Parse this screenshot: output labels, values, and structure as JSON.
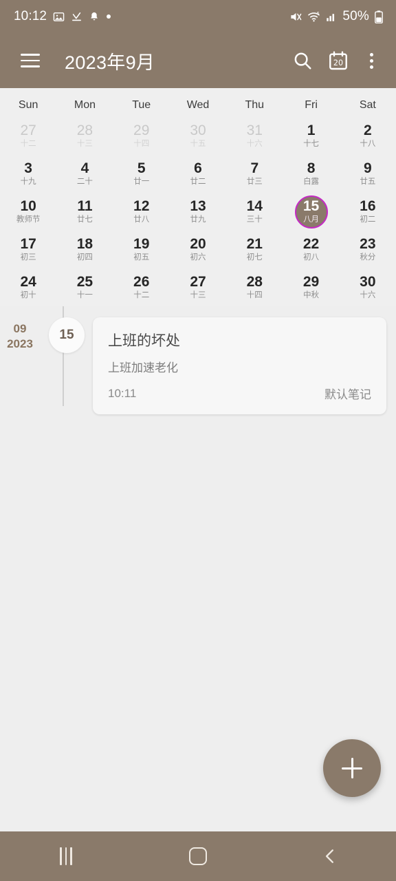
{
  "status_bar": {
    "clock": "10:12",
    "battery_percent": "50%",
    "left_icons": [
      "image-icon",
      "download-complete-icon",
      "bell-icon",
      "dot-indicator-icon"
    ],
    "right_icons": [
      "mute-icon",
      "wifi-6-icon",
      "signal-bars-icon",
      "battery-icon"
    ]
  },
  "app_bar": {
    "menu_icon": "hamburger-icon",
    "title": "2023年9月",
    "actions": [
      {
        "icon": "search-icon",
        "label": "Search"
      },
      {
        "icon": "calendar-today-icon",
        "label": "20"
      },
      {
        "icon": "overflow-menu-icon",
        "label": "More options"
      }
    ]
  },
  "calendar": {
    "weekdays": [
      "Sun",
      "Mon",
      "Tue",
      "Wed",
      "Thu",
      "Fri",
      "Sat"
    ],
    "weeks": [
      [
        {
          "num": "27",
          "lunar": "十二",
          "outside": true
        },
        {
          "num": "28",
          "lunar": "十三",
          "outside": true
        },
        {
          "num": "29",
          "lunar": "十四",
          "outside": true
        },
        {
          "num": "30",
          "lunar": "十五",
          "outside": true
        },
        {
          "num": "31",
          "lunar": "十六",
          "outside": true
        },
        {
          "num": "1",
          "lunar": "十七",
          "outside": false
        },
        {
          "num": "2",
          "lunar": "十八",
          "outside": false
        }
      ],
      [
        {
          "num": "3",
          "lunar": "十九",
          "outside": false
        },
        {
          "num": "4",
          "lunar": "二十",
          "outside": false
        },
        {
          "num": "5",
          "lunar": "廿一",
          "outside": false
        },
        {
          "num": "6",
          "lunar": "廿二",
          "outside": false
        },
        {
          "num": "7",
          "lunar": "廿三",
          "outside": false
        },
        {
          "num": "8",
          "lunar": "白露",
          "outside": false
        },
        {
          "num": "9",
          "lunar": "廿五",
          "outside": false
        }
      ],
      [
        {
          "num": "10",
          "lunar": "教师节",
          "outside": false
        },
        {
          "num": "11",
          "lunar": "廿七",
          "outside": false
        },
        {
          "num": "12",
          "lunar": "廿八",
          "outside": false
        },
        {
          "num": "13",
          "lunar": "廿九",
          "outside": false
        },
        {
          "num": "14",
          "lunar": "三十",
          "outside": false
        },
        {
          "num": "15",
          "lunar": "八月",
          "outside": false,
          "selected": true
        },
        {
          "num": "16",
          "lunar": "初二",
          "outside": false
        }
      ],
      [
        {
          "num": "17",
          "lunar": "初三",
          "outside": false
        },
        {
          "num": "18",
          "lunar": "初四",
          "outside": false
        },
        {
          "num": "19",
          "lunar": "初五",
          "outside": false
        },
        {
          "num": "20",
          "lunar": "初六",
          "outside": false
        },
        {
          "num": "21",
          "lunar": "初七",
          "outside": false
        },
        {
          "num": "22",
          "lunar": "初八",
          "outside": false
        },
        {
          "num": "23",
          "lunar": "秋分",
          "outside": false
        }
      ],
      [
        {
          "num": "24",
          "lunar": "初十",
          "outside": false
        },
        {
          "num": "25",
          "lunar": "十一",
          "outside": false
        },
        {
          "num": "26",
          "lunar": "十二",
          "outside": false
        },
        {
          "num": "27",
          "lunar": "十三",
          "outside": false
        },
        {
          "num": "28",
          "lunar": "十四",
          "outside": false
        },
        {
          "num": "29",
          "lunar": "中秋",
          "outside": false
        },
        {
          "num": "30",
          "lunar": "十六",
          "outside": false
        }
      ]
    ]
  },
  "agenda": {
    "month": "09",
    "year": "2023",
    "day": "15",
    "event": {
      "title": "上班的坏处",
      "subtitle": "上班加速老化",
      "time": "10:11",
      "category": "默认笔记"
    }
  },
  "fab": {
    "icon": "plus-icon",
    "label": "Add"
  },
  "nav_bar": {
    "buttons": [
      {
        "icon": "recents-icon",
        "label": "Recents"
      },
      {
        "icon": "home-icon",
        "label": "Home"
      },
      {
        "icon": "back-icon",
        "label": "Back"
      }
    ]
  },
  "colors": {
    "brand_brown": "#8a7a6a",
    "selection_ring": "#c32bc3",
    "background": "#eeeeee",
    "agenda_accent": "#8a7560"
  }
}
